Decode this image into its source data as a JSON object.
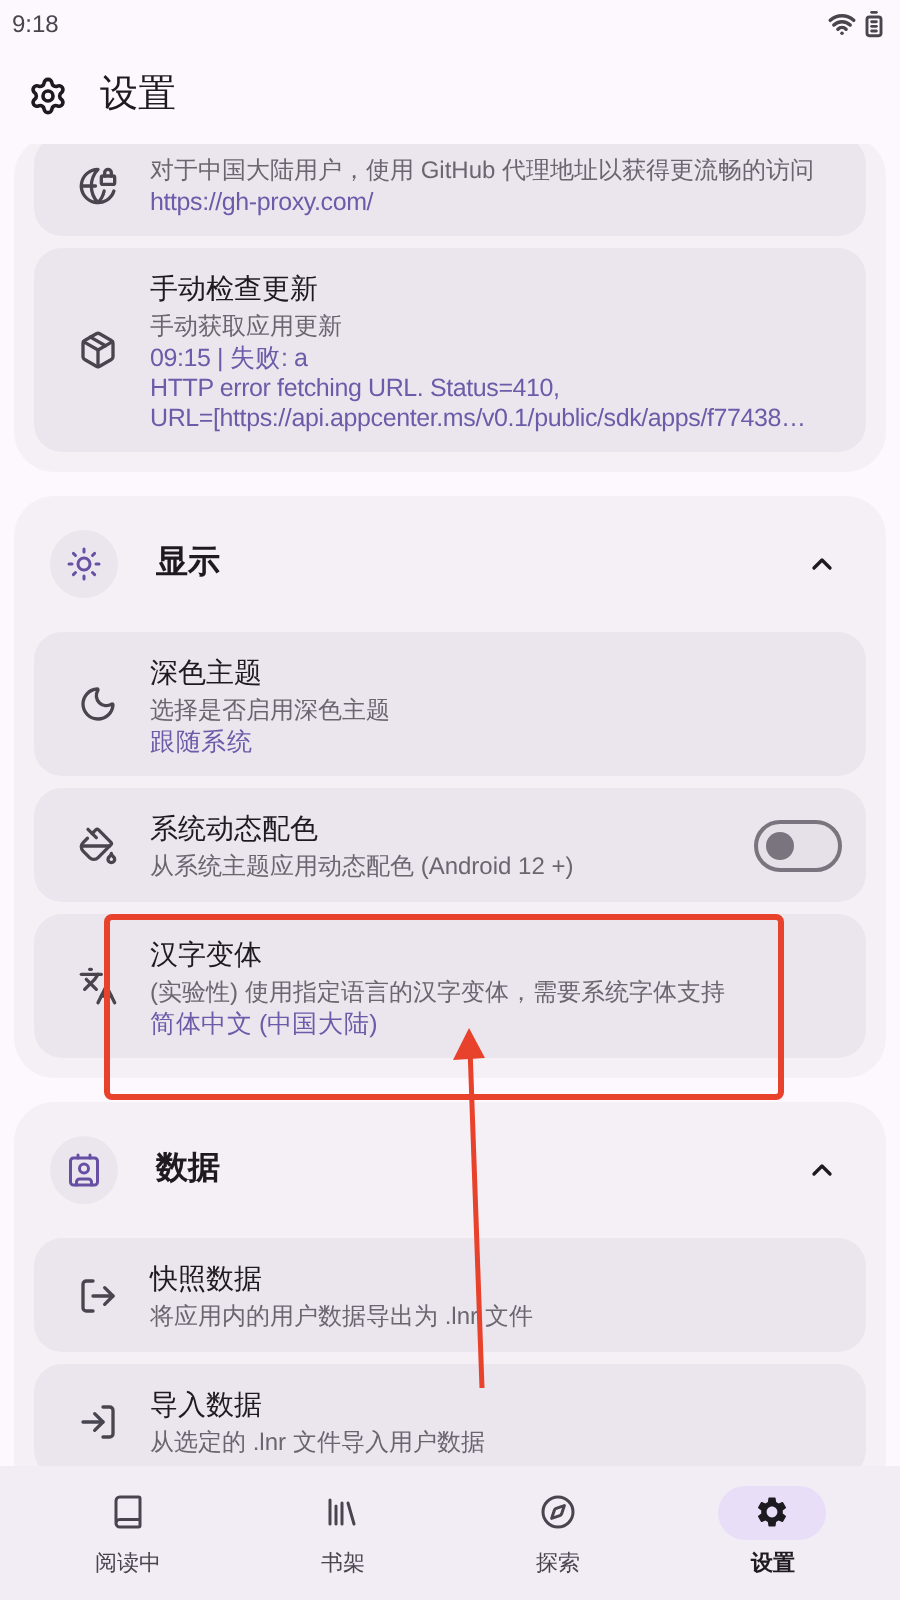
{
  "status_bar": {
    "time": "9:18"
  },
  "header": {
    "title": "设置"
  },
  "sections": [
    {
      "items": [
        {
          "kind": "info",
          "subtitle": "对于中国大陆用户，使用 GitHub 代理地址以获得更流畅的访问",
          "details": [
            "https://gh-proxy.com/"
          ]
        },
        {
          "kind": "info",
          "title": "手动检查更新",
          "subtitle": "手动获取应用更新",
          "details": [
            "09:15 | 失败: a",
            "HTTP error fetching URL. Status=410,",
            "URL=[https://api.appcenter.ms/v0.1/public/sdk/apps/f77438…"
          ]
        }
      ]
    },
    {
      "title": "显示",
      "expanded": true,
      "items": [
        {
          "kind": "info",
          "title": "深色主题",
          "subtitle": "选择是否启用深色主题",
          "details": [
            "跟随系统"
          ]
        },
        {
          "kind": "toggle",
          "title": "系统动态配色",
          "subtitle": "从系统主题应用动态配色 (Android 12 +)",
          "on": false
        },
        {
          "kind": "info",
          "title": "汉字变体",
          "subtitle": "(实验性) 使用指定语言的汉字变体，需要系统字体支持",
          "details": [
            "简体中文 (中国大陆)"
          ]
        }
      ]
    },
    {
      "title": "数据",
      "expanded": true,
      "items": [
        {
          "kind": "info",
          "title": "快照数据",
          "subtitle": "将应用内的用户数据导出为 .lnr 文件"
        },
        {
          "kind": "info",
          "title": "导入数据",
          "subtitle": "从选定的 .lnr 文件导入用户数据"
        }
      ]
    }
  ],
  "nav": [
    {
      "label": "阅读中",
      "selected": false
    },
    {
      "label": "书架",
      "selected": false
    },
    {
      "label": "探索",
      "selected": false
    },
    {
      "label": "设置",
      "selected": true
    }
  ]
}
